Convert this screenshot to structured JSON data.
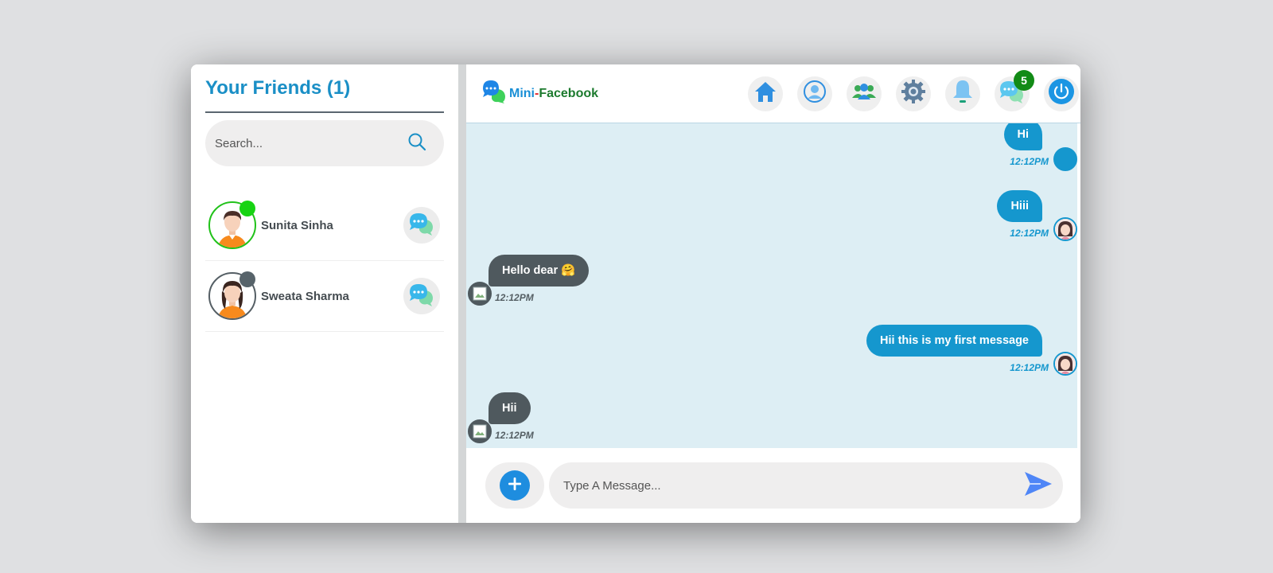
{
  "sidebar": {
    "title": "Your Friends (1)",
    "search": {
      "placeholder": "Search..."
    },
    "friends": [
      {
        "name": "Sunita Sinha",
        "status": "online"
      },
      {
        "name": "Sweata Sharma",
        "status": "offline"
      }
    ]
  },
  "header": {
    "brand": {
      "mini": "Mini",
      "dash": "-",
      "facebook": "Facebook"
    },
    "nav_icons": [
      "home-icon",
      "profile-icon",
      "friends-icon",
      "settings-icon",
      "notifications-icon",
      "messages-icon",
      "power-icon"
    ],
    "messages_badge": "5"
  },
  "chat": {
    "messages": [
      {
        "direction": "out",
        "text": "Hi",
        "time": "12:12PM"
      },
      {
        "direction": "out",
        "text": "Hiii",
        "time": "12:12PM"
      },
      {
        "direction": "in",
        "text": "Hello dear 🤗",
        "time": "12:12PM"
      },
      {
        "direction": "out",
        "text": "Hii this is my first message",
        "time": "12:12PM"
      },
      {
        "direction": "in",
        "text": "Hii",
        "time": "12:12PM"
      }
    ]
  },
  "composer": {
    "placeholder": "Type A Message..."
  },
  "colors": {
    "accent": "#1597ce",
    "incoming": "#4f595e",
    "online": "#17d313",
    "badge": "#128b16"
  }
}
